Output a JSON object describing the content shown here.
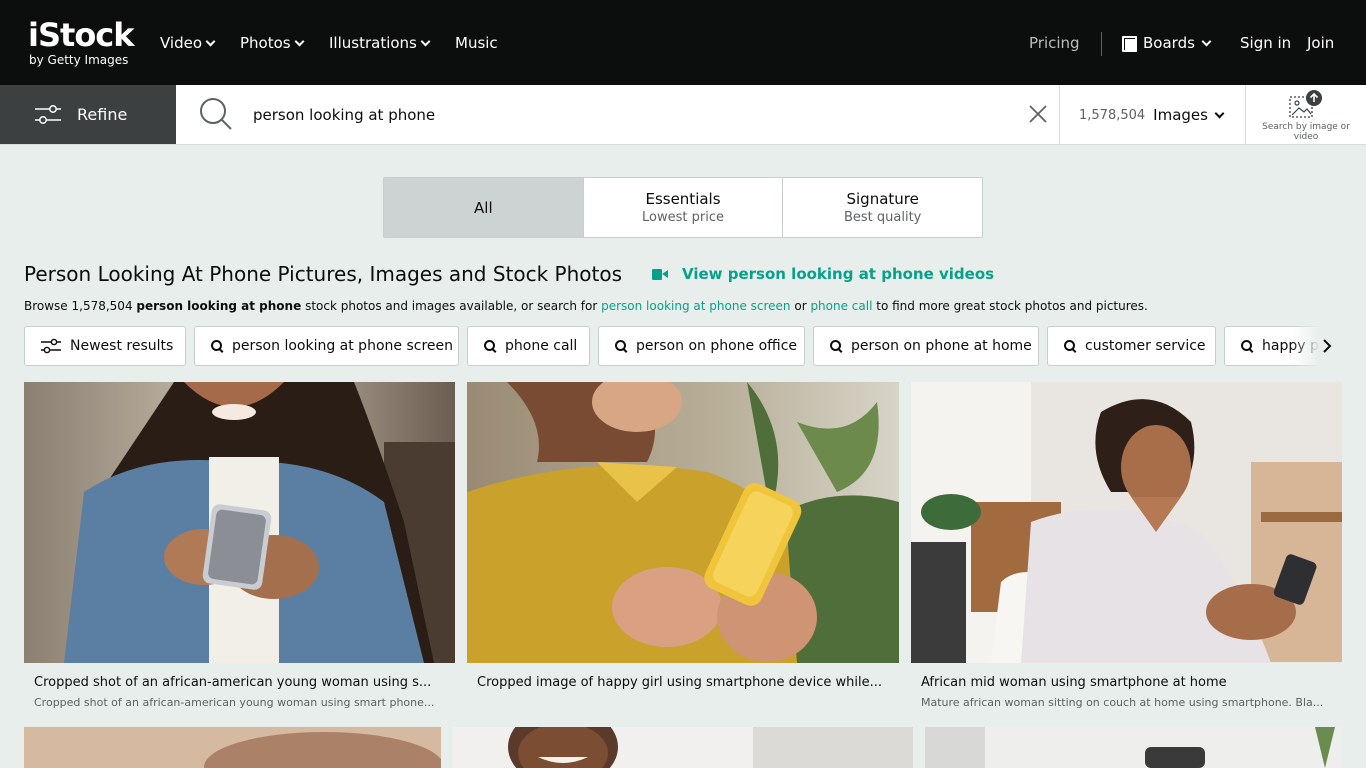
{
  "brand": {
    "name": "iStock",
    "tagline": "by Getty Images"
  },
  "nav": {
    "items": [
      {
        "label": "Video",
        "has_dropdown": true
      },
      {
        "label": "Photos",
        "has_dropdown": true
      },
      {
        "label": "Illustrations",
        "has_dropdown": true
      },
      {
        "label": "Music",
        "has_dropdown": false
      }
    ],
    "pricing": "Pricing",
    "boards": "Boards",
    "sign_in": "Sign in",
    "join": "Join"
  },
  "search": {
    "refine_label": "Refine",
    "query": "person looking at phone",
    "result_count": "1,578,504",
    "media_type": "Images",
    "visual_search_label": "Search by image or video"
  },
  "tabs": [
    {
      "title": "All",
      "subtitle": "",
      "active": true
    },
    {
      "title": "Essentials",
      "subtitle": "Lowest price",
      "active": false
    },
    {
      "title": "Signature",
      "subtitle": "Best quality",
      "active": false
    }
  ],
  "heading": {
    "title": "Person Looking At Phone Pictures, Images and Stock Photos",
    "video_link": "View person looking at phone videos"
  },
  "browse": {
    "prefix": "Browse 1,578,504 ",
    "bold_term": "person looking at phone",
    "middle": " stock photos and images available, or search for ",
    "link1": "person looking at phone screen",
    "or": " or ",
    "link2": "phone call",
    "suffix": " to find more great stock photos and pictures."
  },
  "chips": [
    {
      "label": "Newest results",
      "icon": "sliders-icon"
    },
    {
      "label": "person looking at phone screen",
      "icon": "search-icon"
    },
    {
      "label": "phone call",
      "icon": "search-icon"
    },
    {
      "label": "person on phone office",
      "icon": "search-icon"
    },
    {
      "label": "person on phone at home",
      "icon": "search-icon"
    },
    {
      "label": "customer service",
      "icon": "search-icon"
    },
    {
      "label": "happy people",
      "icon": "search-icon"
    }
  ],
  "results": [
    {
      "caption": "Cropped shot of an african-american young woman using s...",
      "description": "Cropped shot of an african-american young woman using smart phone..."
    },
    {
      "caption": "Cropped image of happy girl using smartphone device while...",
      "description": ""
    },
    {
      "caption": "African mid woman using smartphone at home",
      "description": "Mature african woman sitting on couch at home using smartphone. Bla..."
    }
  ],
  "colors": {
    "topbar": "#0c0d0d",
    "accent": "#08a08a",
    "page_bg": "#e8eeec",
    "refine_bg": "#3c4040",
    "active_tab": "#ccd3d2"
  }
}
